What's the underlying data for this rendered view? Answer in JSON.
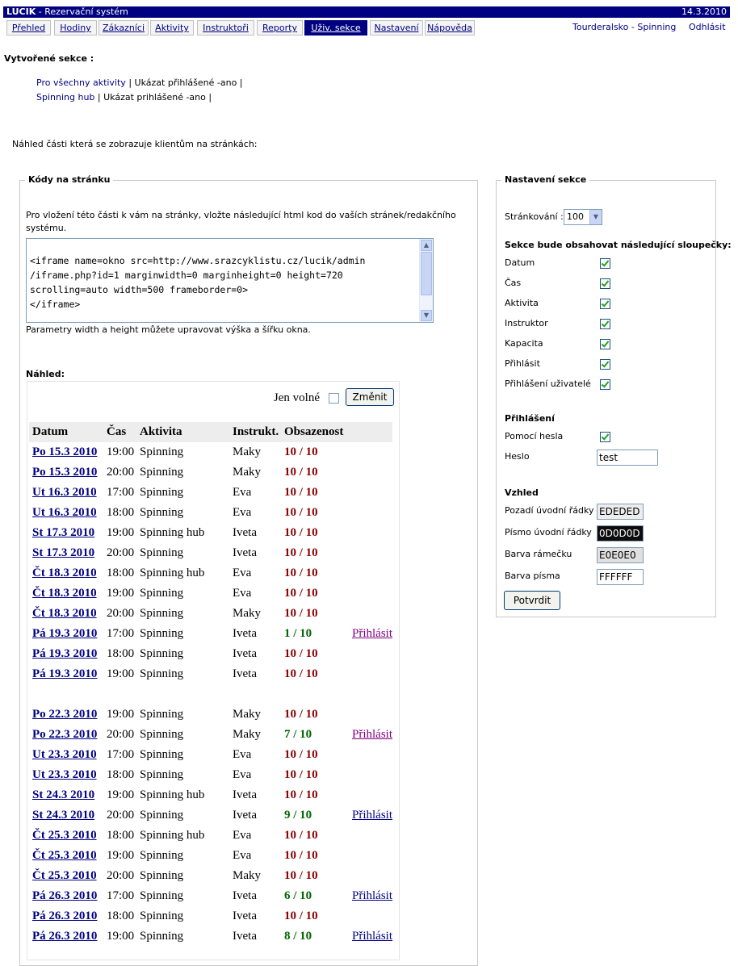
{
  "titlebar": {
    "app_name": "LUCIK",
    "app_subtitle": " - Rezervační systém",
    "date": "14.3.2010"
  },
  "nav": {
    "tabs": [
      "Přehled",
      "Hodiny",
      "Zákazníci",
      "Aktivity",
      "Instruktoři",
      "Reporty",
      "Uživ. sekce",
      "Nastavení",
      "Nápověda"
    ],
    "active_tab": "Uživ. sekce",
    "user": "Tourderalsko - Spinning",
    "logout": "Odhlásit"
  },
  "sections": {
    "title": "Vytvořené sekce :",
    "items": [
      {
        "link": "Pro všechny aktivity",
        "suffix": " | Ukázat přihlášené -ano  |"
      },
      {
        "link": "Spinning hub",
        "suffix": " | Ukázat prihlášené -ano  |"
      }
    ]
  },
  "preview_intro": "Náhled části která se zobrazuje klientům na stránkách:",
  "codes": {
    "legend": "Kódy na stránku",
    "intro": "Pro vložení této části k vám na stránky, vložte následující html kod do vaších stránek/redakčního systému.",
    "code_lines": [
      "<iframe name=okno src=http://www.srazcyklistu.cz/lucik/admin",
      "/iframe.php?id=1 marginwidth=0 marginheight=0 height=720",
      "scrolling=auto width=500 frameborder=0>",
      "</iframe>"
    ],
    "hint": "Parametry width a height můžete upravovat výška a šířku okna."
  },
  "preview": {
    "label": "Náhled:",
    "free_label": "Jen volné",
    "change_button": "Změnit",
    "columns": [
      "Datum",
      "Čas",
      "Aktivita",
      "Instrukt.",
      "Obsazenost"
    ],
    "rows": [
      {
        "date": "Po 15.3 2010",
        "time": "19:00",
        "activity": "Spinning",
        "instructor": "Maky",
        "occupancy": "10 / 10",
        "full": true,
        "action": ""
      },
      {
        "date": "Po 15.3 2010",
        "time": "20:00",
        "activity": "Spinning",
        "instructor": "Maky",
        "occupancy": "10 / 10",
        "full": true,
        "action": ""
      },
      {
        "date": "Ut 16.3 2010",
        "time": "17:00",
        "activity": "Spinning",
        "instructor": "Eva",
        "occupancy": "10 / 10",
        "full": true,
        "action": ""
      },
      {
        "date": "Ut 16.3 2010",
        "time": "18:00",
        "activity": "Spinning",
        "instructor": "Eva",
        "occupancy": "10 / 10",
        "full": true,
        "action": ""
      },
      {
        "date": "St 17.3 2010",
        "time": "19:00",
        "activity": "Spinning hub",
        "instructor": "Iveta",
        "occupancy": "10 / 10",
        "full": true,
        "action": ""
      },
      {
        "date": "St 17.3 2010",
        "time": "20:00",
        "activity": "Spinning",
        "instructor": "Iveta",
        "occupancy": "10 / 10",
        "full": true,
        "action": ""
      },
      {
        "date": "Čt 18.3 2010",
        "time": "18:00",
        "activity": "Spinning hub",
        "instructor": "Eva",
        "occupancy": "10 / 10",
        "full": true,
        "action": ""
      },
      {
        "date": "Čt 18.3 2010",
        "time": "19:00",
        "activity": "Spinning",
        "instructor": "Eva",
        "occupancy": "10 / 10",
        "full": true,
        "action": ""
      },
      {
        "date": "Čt 18.3 2010",
        "time": "20:00",
        "activity": "Spinning",
        "instructor": "Maky",
        "occupancy": "10 / 10",
        "full": true,
        "action": ""
      },
      {
        "date": "Pá 19.3 2010",
        "time": "17:00",
        "activity": "Spinning",
        "instructor": "Iveta",
        "occupancy": "1 / 10",
        "full": false,
        "action": "Přihlásit",
        "visited": true
      },
      {
        "date": "Pá 19.3 2010",
        "time": "18:00",
        "activity": "Spinning",
        "instructor": "Iveta",
        "occupancy": "10 / 10",
        "full": true,
        "action": ""
      },
      {
        "date": "Pá 19.3 2010",
        "time": "19:00",
        "activity": "Spinning",
        "instructor": "Iveta",
        "occupancy": "10 / 10",
        "full": true,
        "action": ""
      },
      {
        "date": "Po 22.3 2010",
        "time": "19:00",
        "activity": "Spinning",
        "instructor": "Maky",
        "occupancy": "10 / 10",
        "full": true,
        "action": ""
      },
      {
        "date": "Po 22.3 2010",
        "time": "20:00",
        "activity": "Spinning",
        "instructor": "Maky",
        "occupancy": "7 / 10",
        "full": false,
        "action": "Přihlásit",
        "visited": true
      },
      {
        "date": "Ut 23.3 2010",
        "time": "17:00",
        "activity": "Spinning",
        "instructor": "Eva",
        "occupancy": "10 / 10",
        "full": true,
        "action": ""
      },
      {
        "date": "Ut 23.3 2010",
        "time": "18:00",
        "activity": "Spinning",
        "instructor": "Eva",
        "occupancy": "10 / 10",
        "full": true,
        "action": ""
      },
      {
        "date": "St 24.3 2010",
        "time": "19:00",
        "activity": "Spinning hub",
        "instructor": "Iveta",
        "occupancy": "10 / 10",
        "full": true,
        "action": ""
      },
      {
        "date": "St 24.3 2010",
        "time": "20:00",
        "activity": "Spinning",
        "instructor": "Iveta",
        "occupancy": "9 / 10",
        "full": false,
        "action": "Přihlásit",
        "visited": false
      },
      {
        "date": "Čt 25.3 2010",
        "time": "18:00",
        "activity": "Spinning hub",
        "instructor": "Eva",
        "occupancy": "10 / 10",
        "full": true,
        "action": ""
      },
      {
        "date": "Čt 25.3 2010",
        "time": "19:00",
        "activity": "Spinning",
        "instructor": "Eva",
        "occupancy": "10 / 10",
        "full": true,
        "action": ""
      },
      {
        "date": "Čt 25.3 2010",
        "time": "20:00",
        "activity": "Spinning",
        "instructor": "Maky",
        "occupancy": "10 / 10",
        "full": true,
        "action": ""
      },
      {
        "date": "Pá 26.3 2010",
        "time": "17:00",
        "activity": "Spinning",
        "instructor": "Iveta",
        "occupancy": "6 / 10",
        "full": false,
        "action": "Přihlásit",
        "visited": false
      },
      {
        "date": "Pá 26.3 2010",
        "time": "18:00",
        "activity": "Spinning",
        "instructor": "Iveta",
        "occupancy": "10 / 10",
        "full": true,
        "action": ""
      },
      {
        "date": "Pá 26.3 2010",
        "time": "19:00",
        "activity": "Spinning",
        "instructor": "Iveta",
        "occupancy": "8 / 10",
        "full": false,
        "action": "Přihlásit",
        "visited": false
      }
    ]
  },
  "settings": {
    "legend": "Nastavení sekce",
    "paging_label": "Stránkování :",
    "paging_value": "100",
    "columns_title": "Sekce bude obsahovat následující sloupečky:",
    "columns": [
      {
        "label": "Datum",
        "checked": true
      },
      {
        "label": "Čas",
        "checked": true
      },
      {
        "label": "Aktivita",
        "checked": true
      },
      {
        "label": "Instruktor",
        "checked": true
      },
      {
        "label": "Kapacita",
        "checked": true
      },
      {
        "label": "Přihlásit",
        "checked": true
      },
      {
        "label": "Přihlášení uživatelé",
        "checked": true
      }
    ],
    "login_title": "Přihlášení",
    "password_label": "Pomocí hesla",
    "password_checked": true,
    "heslo_label": "Heslo",
    "heslo_value": "test",
    "look_title": "Vzhled",
    "look": [
      {
        "label": "Pozadí úvodní řádky",
        "value": "EDEDED",
        "bg": "#EDEDED",
        "fg": "#000000"
      },
      {
        "label": "Písmo úvodní řádky",
        "value": "0D0D0D",
        "bg": "#0D0D0D",
        "fg": "#FFFFFF"
      },
      {
        "label": "Barva rámečku",
        "value": "E0E0E0",
        "bg": "#E0E0E0",
        "fg": "#000000"
      },
      {
        "label": "Barva písma",
        "value": "FFFFFF",
        "bg": "#FFFFFF",
        "fg": "#000000"
      }
    ],
    "confirm_button": "Potvrdit"
  },
  "colors": {
    "navy": "#000080",
    "full": "#8b0000",
    "free": "#006400",
    "visited_link": "#800080"
  }
}
